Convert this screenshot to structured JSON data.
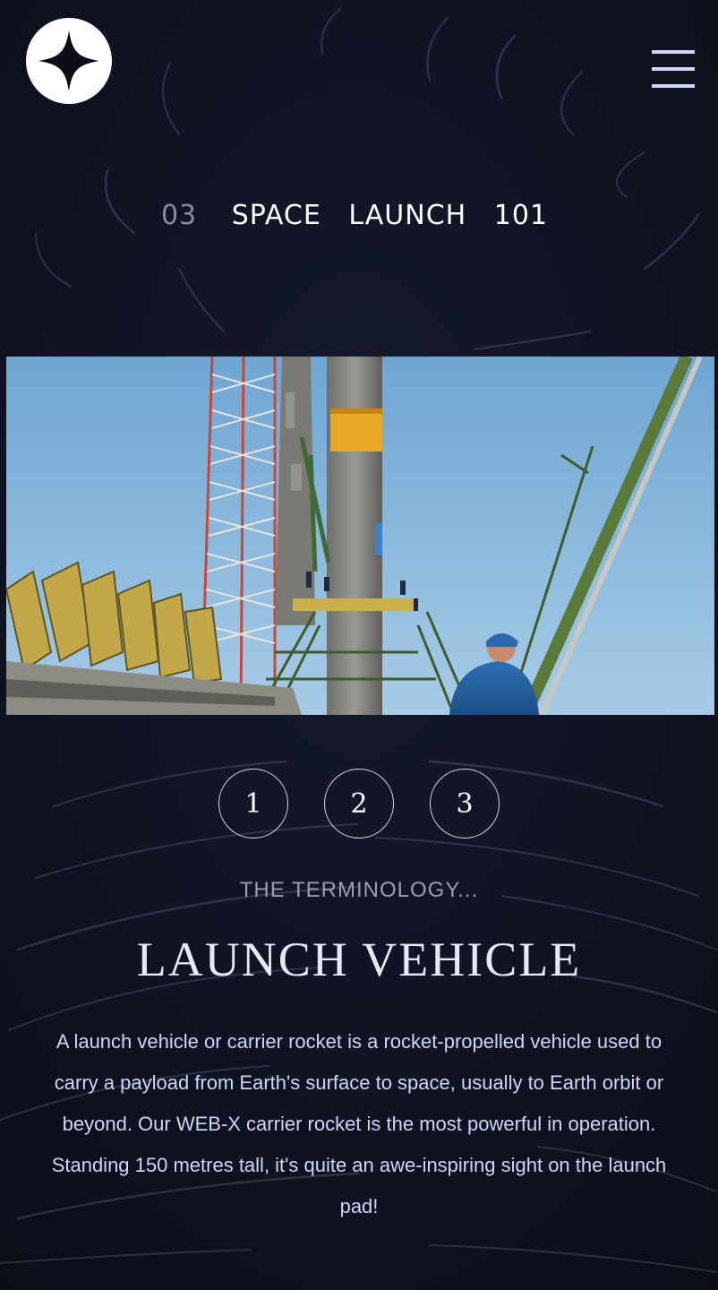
{
  "header": {
    "logo_icon": "four-point-star-icon",
    "menu_icon": "hamburger-menu-icon"
  },
  "page": {
    "number": "03",
    "title_words": [
      "SPACE",
      "LAUNCH",
      "101"
    ]
  },
  "hero_image": {
    "subject": "rocket-on-launch-pad-photo"
  },
  "steps": [
    "1",
    "2",
    "3"
  ],
  "content": {
    "eyebrow": "THE TERMINOLOGY...",
    "title": "LAUNCH VEHICLE",
    "description": "A launch vehicle or carrier rocket is a rocket-propelled vehicle used to carry a payload from Earth's surface to space, usually to Earth orbit or beyond. Our WEB-X carrier rocket is the most powerful in operation. Standing 150 metres tall, it's quite an awe-inspiring sight on the launch pad!"
  },
  "colors": {
    "background": "#0b0d17",
    "accent": "#d0d6f9",
    "muted": "#8a8d99"
  }
}
